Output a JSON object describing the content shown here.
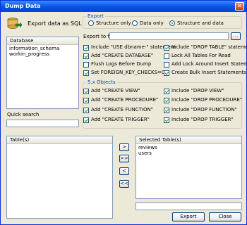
{
  "window": {
    "title": "Dump Data",
    "close_glyph": "✕"
  },
  "header": {
    "text": "Export data as SQL",
    "icon": "database-export-icon"
  },
  "export": {
    "legend": "Export",
    "options": [
      "Structure only",
      "Data only",
      "Structure and data"
    ],
    "selected": "Structure and data",
    "file_label": "Export to file:",
    "file_value": "",
    "browse_label": "..."
  },
  "database": {
    "header": "Database",
    "items": [
      "information_schema",
      "workin_progress"
    ]
  },
  "quick_search": {
    "label": "Quick search",
    "value": ""
  },
  "options_left": [
    {
      "label": "Include \"USE dbname-\" statement",
      "checked": true
    },
    {
      "label": "Add \"CREATE DATABASE\"",
      "checked": true
    },
    {
      "label": "Flush Logs Before Dump",
      "checked": false
    },
    {
      "label": "Set FOREIGN_KEY_CHECKS=0",
      "checked": true
    }
  ],
  "options_right": [
    {
      "label": "Include \"DROP TABLE\" statement",
      "checked": true
    },
    {
      "label": "Lock All Tables For Read",
      "checked": false
    },
    {
      "label": "Add Lock Around Insert Statements",
      "checked": false
    },
    {
      "label": "Create Bulk Insert Statements",
      "checked": true
    }
  ],
  "objects5x": {
    "legend": "5.x Objects",
    "left": [
      {
        "label": "Add \"CREATE VIEW\"",
        "checked": true
      },
      {
        "label": "Add \"CREATE PROCEDURE\"",
        "checked": true
      },
      {
        "label": "Add \"CREATE FUNCTION\"",
        "checked": true
      },
      {
        "label": "Add \"CREATE TRIGGER\"",
        "checked": true
      }
    ],
    "right": [
      {
        "label": "Include \"DROP VIEW\"",
        "checked": true
      },
      {
        "label": "Include \"DROP PROCEDURE\"",
        "checked": true
      },
      {
        "label": "Include \"DROP FUNCTION\"",
        "checked": true
      },
      {
        "label": "Include \"DROP TRIGGER\"",
        "checked": true
      }
    ]
  },
  "tables": {
    "header": "Table(s)",
    "items": []
  },
  "selected_tables": {
    "header": "Selected Table(s)",
    "items": [
      "reviews",
      "users"
    ]
  },
  "move_buttons": [
    ">",
    ">>",
    "<",
    "<<"
  ],
  "filter_value": "",
  "buttons": {
    "export": "Export",
    "close": "Close"
  }
}
